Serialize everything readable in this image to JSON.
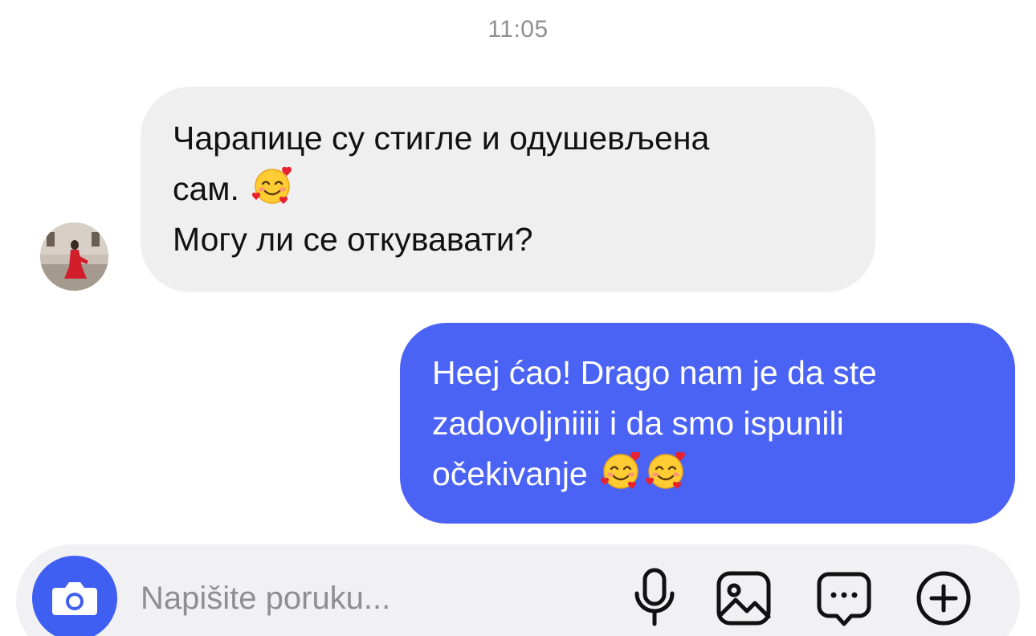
{
  "conversation": {
    "timestamp": "11:05",
    "messages": [
      {
        "direction": "incoming",
        "lines": [
          "Чарапице су стигле и одушевљена",
          "сам.",
          "Могу ли се откувавати?"
        ],
        "emoji": [
          "smiling-face-with-hearts"
        ]
      },
      {
        "direction": "outgoing",
        "lines": [
          "Heej ćao! Drago nam je da ste",
          "zadovoljniiii i da smo ispunili",
          "očekivanje"
        ],
        "emoji": [
          "smiling-face-with-hearts",
          "smiling-face-with-hearts"
        ]
      }
    ]
  },
  "composer": {
    "placeholder": "Napišite poruku...",
    "value": "",
    "icons": [
      "camera-icon",
      "microphone-icon",
      "image-icon",
      "sticker-chat-icon",
      "add-icon"
    ]
  },
  "colors": {
    "incoming_bubble": "#efefef",
    "outgoing_bubble": "#4b63f5",
    "camera_button": "#3f5ef2",
    "timestamp": "#8e8e93"
  }
}
